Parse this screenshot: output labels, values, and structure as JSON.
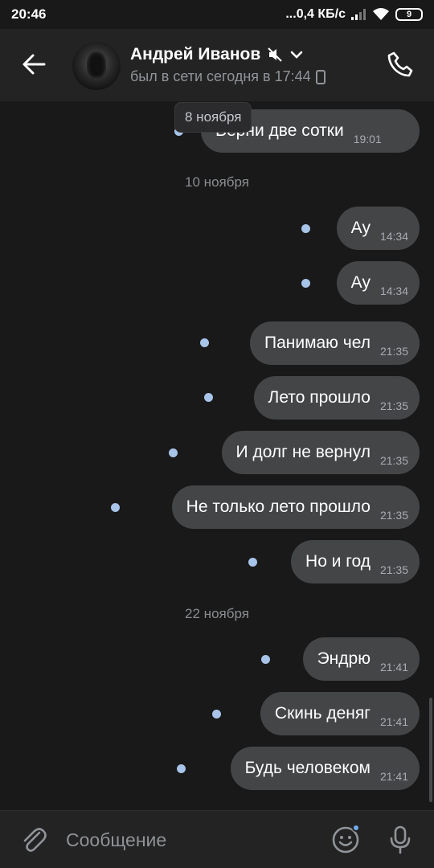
{
  "status_bar": {
    "time": "20:46",
    "network_speed": "...0,4 КБ/с",
    "battery": "9"
  },
  "header": {
    "contact_name": "Андрей Иванов",
    "last_seen": "был в сети сегодня в 17:44",
    "icons": [
      "back-arrow-icon",
      "mute-icon",
      "chevron-down-icon",
      "mobile-icon",
      "phone-icon"
    ]
  },
  "floating_date": "8 ноября",
  "messages": [
    {
      "text": "Верни две сотки",
      "time": "19:01"
    },
    {
      "text": "Ау",
      "time": "14:34"
    },
    {
      "text": "Ау",
      "time": "14:34"
    },
    {
      "text": "Панимаю чел",
      "time": "21:35"
    },
    {
      "text": "Лето прошло",
      "time": "21:35"
    },
    {
      "text": "И долг не вернул",
      "time": "21:35"
    },
    {
      "text": "Не только лето прошло",
      "time": "21:35"
    },
    {
      "text": "Но и год",
      "time": "21:35"
    },
    {
      "text": "Эндрю",
      "time": "21:41"
    },
    {
      "text": "Скинь деняг",
      "time": "21:41"
    },
    {
      "text": "Будь человеком",
      "time": "21:41"
    }
  ],
  "date_separators": [
    "10 ноября",
    "22 ноября"
  ],
  "composer": {
    "placeholder": "Сообщение",
    "icons": [
      "paperclip-icon",
      "emoji-icon",
      "microphone-icon"
    ]
  },
  "colors": {
    "background": "#19191a",
    "header": "#232324",
    "bubble": "#444547",
    "unread_dot": "#a8c4e8",
    "accent": "#71aaeb"
  }
}
